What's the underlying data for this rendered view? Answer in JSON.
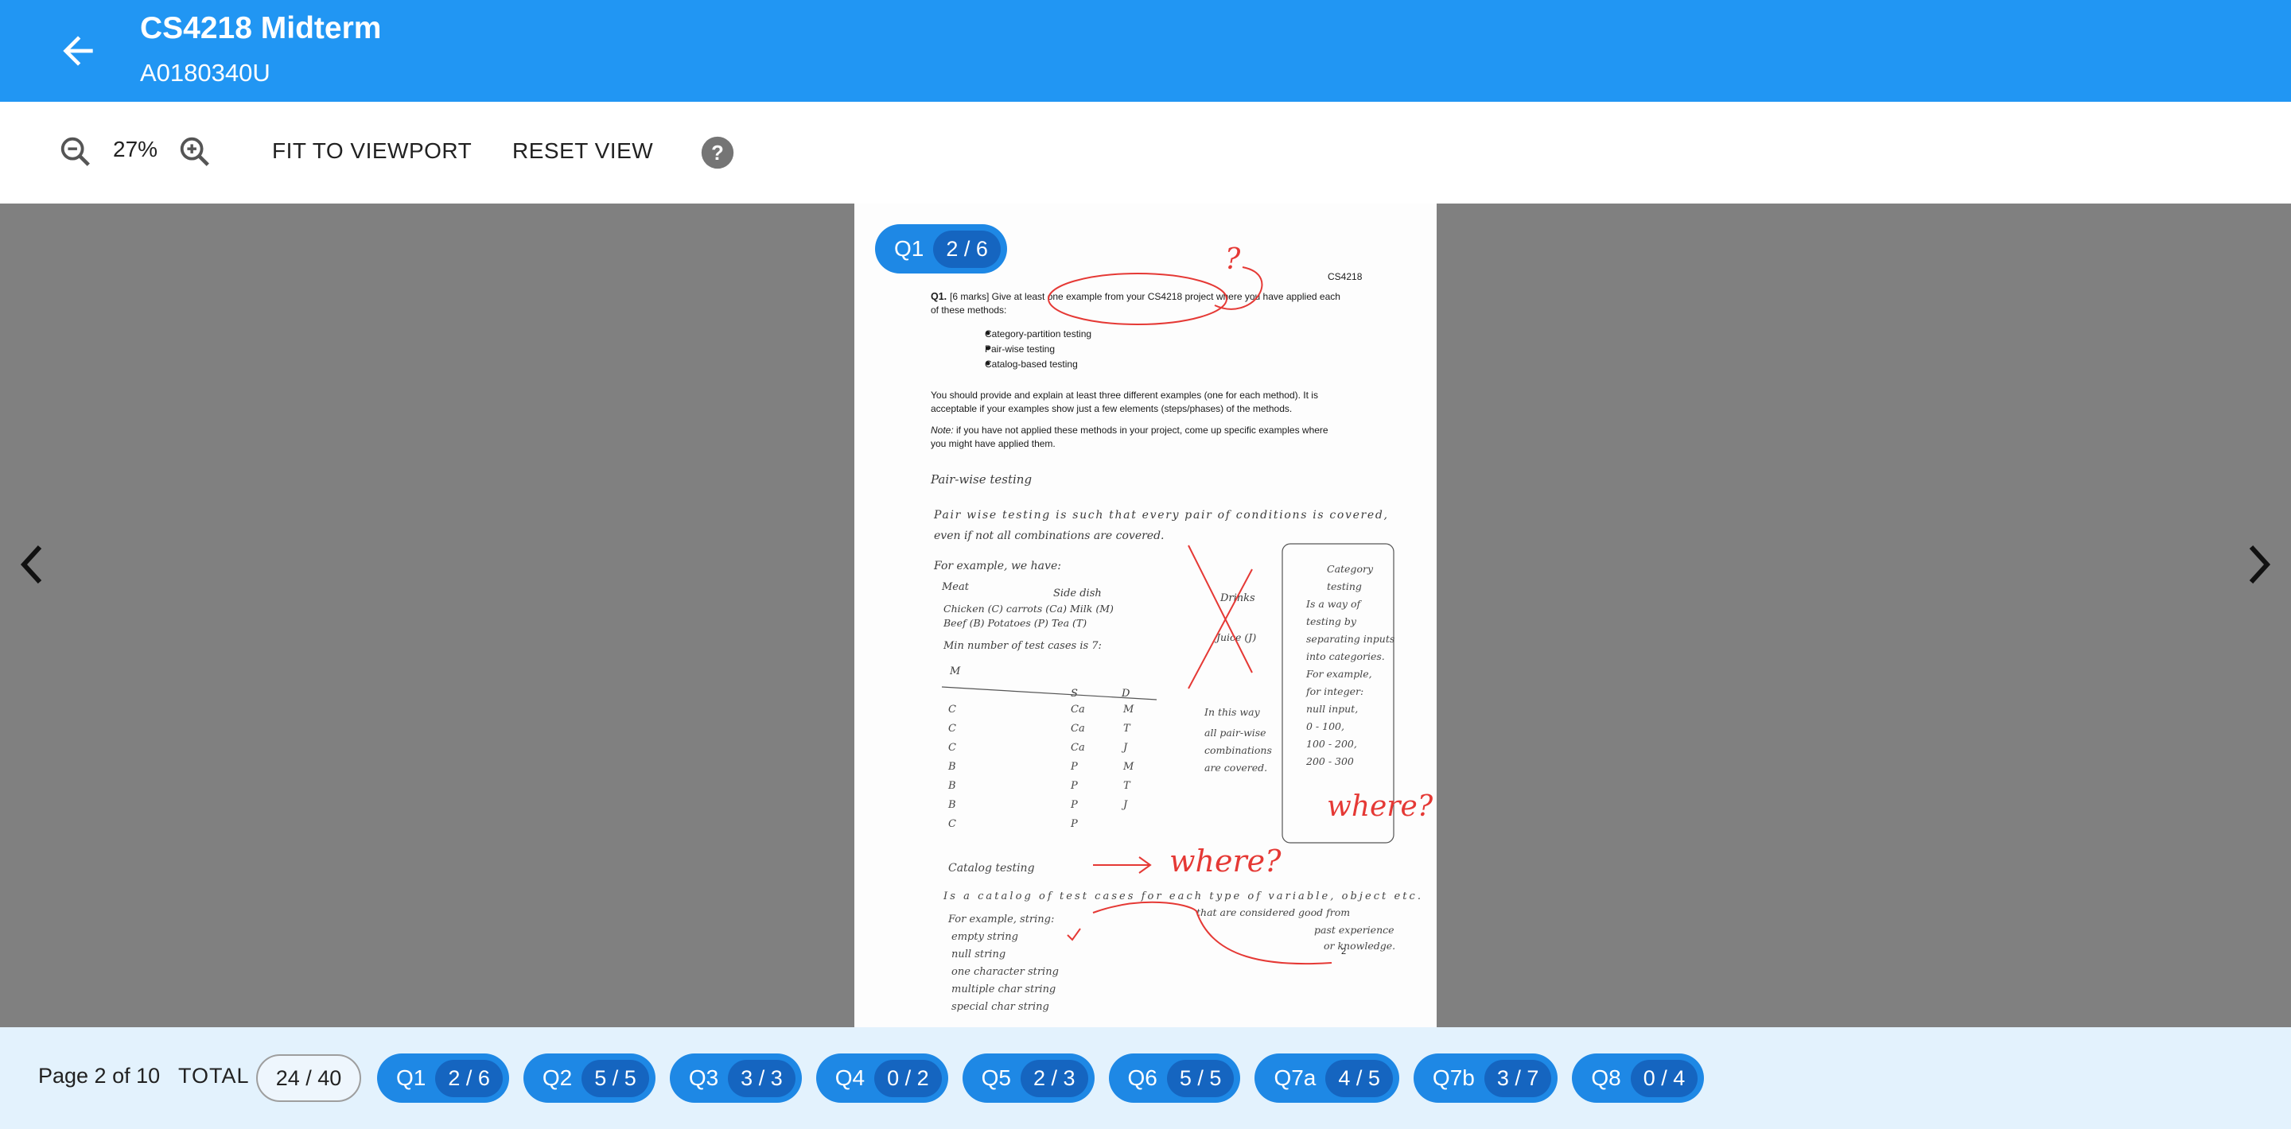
{
  "app": {
    "title": "CS4218 Midterm",
    "subtitle": "A0180340U"
  },
  "toolbar": {
    "zoom": "27%",
    "fit_label": "FIT TO VIEWPORT",
    "reset_label": "RESET VIEW"
  },
  "page_chip": {
    "label": "Q1",
    "score": "2 / 6"
  },
  "document": {
    "header": "CS4218",
    "q_label": "Q1.",
    "q_text_1": "[6 marks] Give at least one example from your CS4218 project where you have applied each",
    "q_text_2": "of these methods:",
    "bullets": [
      "Category-partition testing",
      "Pair-wise testing",
      "Catalog-based testing"
    ],
    "para1_line1": "You should provide and explain at least three different examples (one for each method). It is",
    "para1_line2": "acceptable if your examples show just a few elements (steps/phases) of the methods.",
    "note_label": "Note:",
    "note_line1": "if you have not applied these methods in your project, come up specific examples where",
    "note_line2": "you might have applied them.",
    "hw_heading_1": "Pair-wise testing",
    "hw_lines_1": [
      "Pair wise testing is such that every pair of conditions is covered,",
      "even if not all combinations are covered.",
      "For example, we have:"
    ],
    "hw_table_headers": [
      "Meat",
      "Side dish",
      "Drinks"
    ],
    "hw_table_opts": [
      "Chicken (C)  carrots (Ca)  Milk (M)",
      "Beef (B)  Potatoes (P)  Tea (T)",
      "Juice (J)"
    ],
    "hw_count": "Min number of test cases is 7:",
    "hw_cols": [
      "M",
      "S",
      "D"
    ],
    "hw_rows": [
      [
        "C",
        "Ca",
        "M"
      ],
      [
        "C",
        "Ca",
        "T"
      ],
      [
        "C",
        "Ca",
        "J"
      ],
      [
        "B",
        "P",
        "M"
      ],
      [
        "B",
        "P",
        "T"
      ],
      [
        "B",
        "P",
        "J"
      ],
      [
        "C",
        "P",
        ""
      ]
    ],
    "hw_side_note": [
      "In this way",
      "all pair-wise",
      "combinations",
      "are covered."
    ],
    "hw_category": [
      "Category",
      "testing",
      "Is a way of",
      "testing by",
      "separating inputs",
      "into categories.",
      "For example,",
      "for integer:",
      "null input,",
      "0 - 100,",
      "100 - 200,",
      "200 - 300"
    ],
    "hw_heading_2": "Catalog testing",
    "hw_lines_2": [
      "Is a catalog of test cases for each type of variable, object etc.",
      "that are considered good from",
      "For example, string:",
      "past experience",
      "or knowledge."
    ],
    "hw_strings": [
      "empty string",
      "null string",
      "one character string",
      "multiple char string",
      "special char string"
    ],
    "red_marks": [
      "?",
      "where?",
      "where?"
    ],
    "page_number": "2"
  },
  "footer": {
    "page_info": "Page 2 of 10",
    "total_label": "TOTAL",
    "total_score": "24 / 40",
    "questions": [
      {
        "label": "Q1",
        "score": "2 / 6"
      },
      {
        "label": "Q2",
        "score": "5 / 5"
      },
      {
        "label": "Q3",
        "score": "3 / 3"
      },
      {
        "label": "Q4",
        "score": "0 / 2"
      },
      {
        "label": "Q5",
        "score": "2 / 3"
      },
      {
        "label": "Q6",
        "score": "5 / 5"
      },
      {
        "label": "Q7a",
        "score": "4 / 5"
      },
      {
        "label": "Q7b",
        "score": "3 / 7"
      },
      {
        "label": "Q8",
        "score": "0 / 4"
      }
    ]
  },
  "colors": {
    "primary": "#2196f3",
    "chip": "#1e88e5",
    "chip_score": "#1565c0",
    "footer_bg": "#e3f2fd",
    "annotation": "#e53935"
  }
}
